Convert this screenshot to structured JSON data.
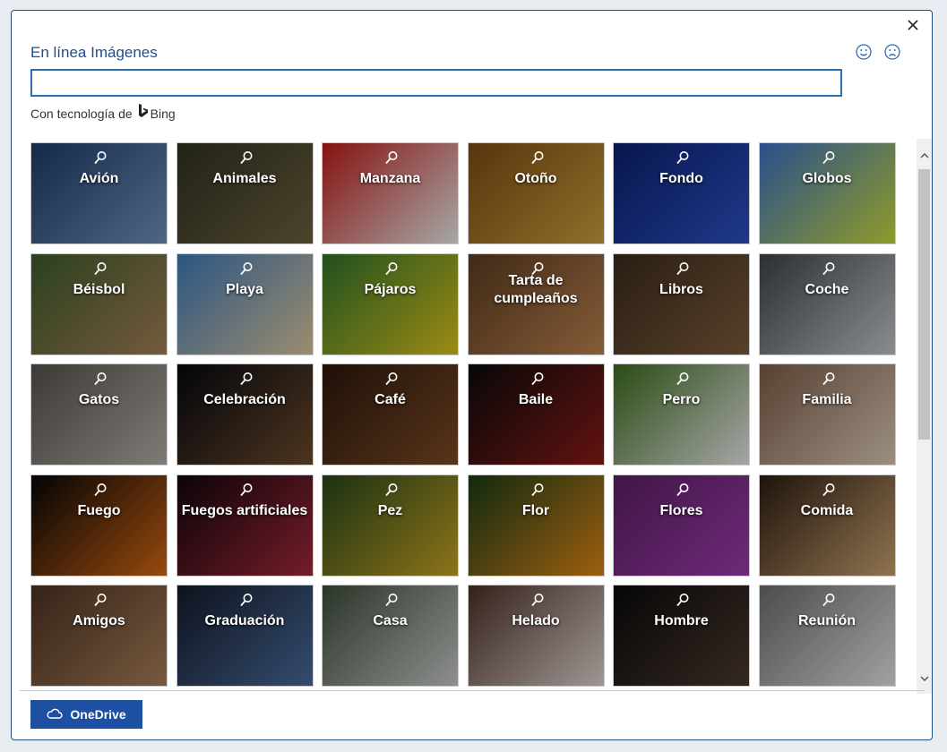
{
  "dialog": {
    "title": "En línea Imágenes",
    "close_icon": "close-icon",
    "feedback": [
      "smile-icon",
      "frown-icon"
    ]
  },
  "search": {
    "value": "",
    "placeholder": ""
  },
  "powered_by": {
    "text": "Con tecnología de",
    "brand": "Bing"
  },
  "categories": [
    {
      "label": "Avión",
      "colors": [
        "#1d3a66",
        "#6e8fb8"
      ]
    },
    {
      "label": "Animales",
      "colors": [
        "#2f3020",
        "#6b5e3e"
      ]
    },
    {
      "label": "Manzana",
      "colors": [
        "#b81b17",
        "#e8e8e8"
      ]
    },
    {
      "label": "Otoño",
      "colors": [
        "#7a4a12",
        "#c99a3c"
      ]
    },
    {
      "label": "Fondo",
      "colors": [
        "#0b1f6e",
        "#2d4fbf"
      ]
    },
    {
      "label": "Globos",
      "colors": [
        "#3a6ec2",
        "#c6d73a"
      ]
    },
    {
      "label": "Béisbol",
      "colors": [
        "#3c5a2a",
        "#a27d56"
      ]
    },
    {
      "label": "Playa",
      "colors": [
        "#3c78b5",
        "#d9c29a"
      ]
    },
    {
      "label": "Pájaros",
      "colors": [
        "#2f6f2a",
        "#d7c11d"
      ]
    },
    {
      "label": "Tarta de cumpleaños",
      "colors": [
        "#5a3a20",
        "#b8804e"
      ]
    },
    {
      "label": "Libros",
      "colors": [
        "#3a2a1c",
        "#7a5a3a"
      ]
    },
    {
      "label": "Coche",
      "colors": [
        "#3c4248",
        "#c0c4c8"
      ]
    },
    {
      "label": "Gatos",
      "colors": [
        "#55514c",
        "#b0aba3"
      ]
    },
    {
      "label": "Celebración",
      "colors": [
        "#05070f",
        "#6b4a2c"
      ]
    },
    {
      "label": "Café",
      "colors": [
        "#2b160b",
        "#7a4a25"
      ]
    },
    {
      "label": "Baile",
      "colors": [
        "#0b0b0b",
        "#8a1a18"
      ]
    },
    {
      "label": "Perro",
      "colors": [
        "#3b6a1e",
        "#e6e6e6"
      ]
    },
    {
      "label": "Familia",
      "colors": [
        "#7a5a46",
        "#d7c7b4"
      ]
    },
    {
      "label": "Fuego",
      "colors": [
        "#050505",
        "#d36514"
      ]
    },
    {
      "label": "Fuegos artificiales",
      "colors": [
        "#12050a",
        "#a0283a"
      ]
    },
    {
      "label": "Pez",
      "colors": [
        "#254418",
        "#c4a126"
      ]
    },
    {
      "label": "Flor",
      "colors": [
        "#173a14",
        "#d98316"
      ]
    },
    {
      "label": "Flores",
      "colors": [
        "#5a1e62",
        "#9a3aa8"
      ]
    },
    {
      "label": "Comida",
      "colors": [
        "#2a1c10",
        "#c8a070"
      ]
    },
    {
      "label": "Amigos",
      "colors": [
        "#4a3020",
        "#a67c58"
      ]
    },
    {
      "label": "Graduación",
      "colors": [
        "#141a2a",
        "#4a6a9a"
      ]
    },
    {
      "label": "Casa",
      "colors": [
        "#3d4a3a",
        "#c4c7c4"
      ]
    },
    {
      "label": "Helado",
      "colors": [
        "#4a2e26",
        "#dcd2cc"
      ]
    },
    {
      "label": "Hombre",
      "colors": [
        "#0a0a0a",
        "#4a382e"
      ]
    },
    {
      "label": "Reunión",
      "colors": [
        "#6a6a6a",
        "#e0e0e0"
      ]
    }
  ],
  "footer": {
    "onedrive_label": "OneDrive",
    "onedrive_icon": "cloud-icon"
  }
}
